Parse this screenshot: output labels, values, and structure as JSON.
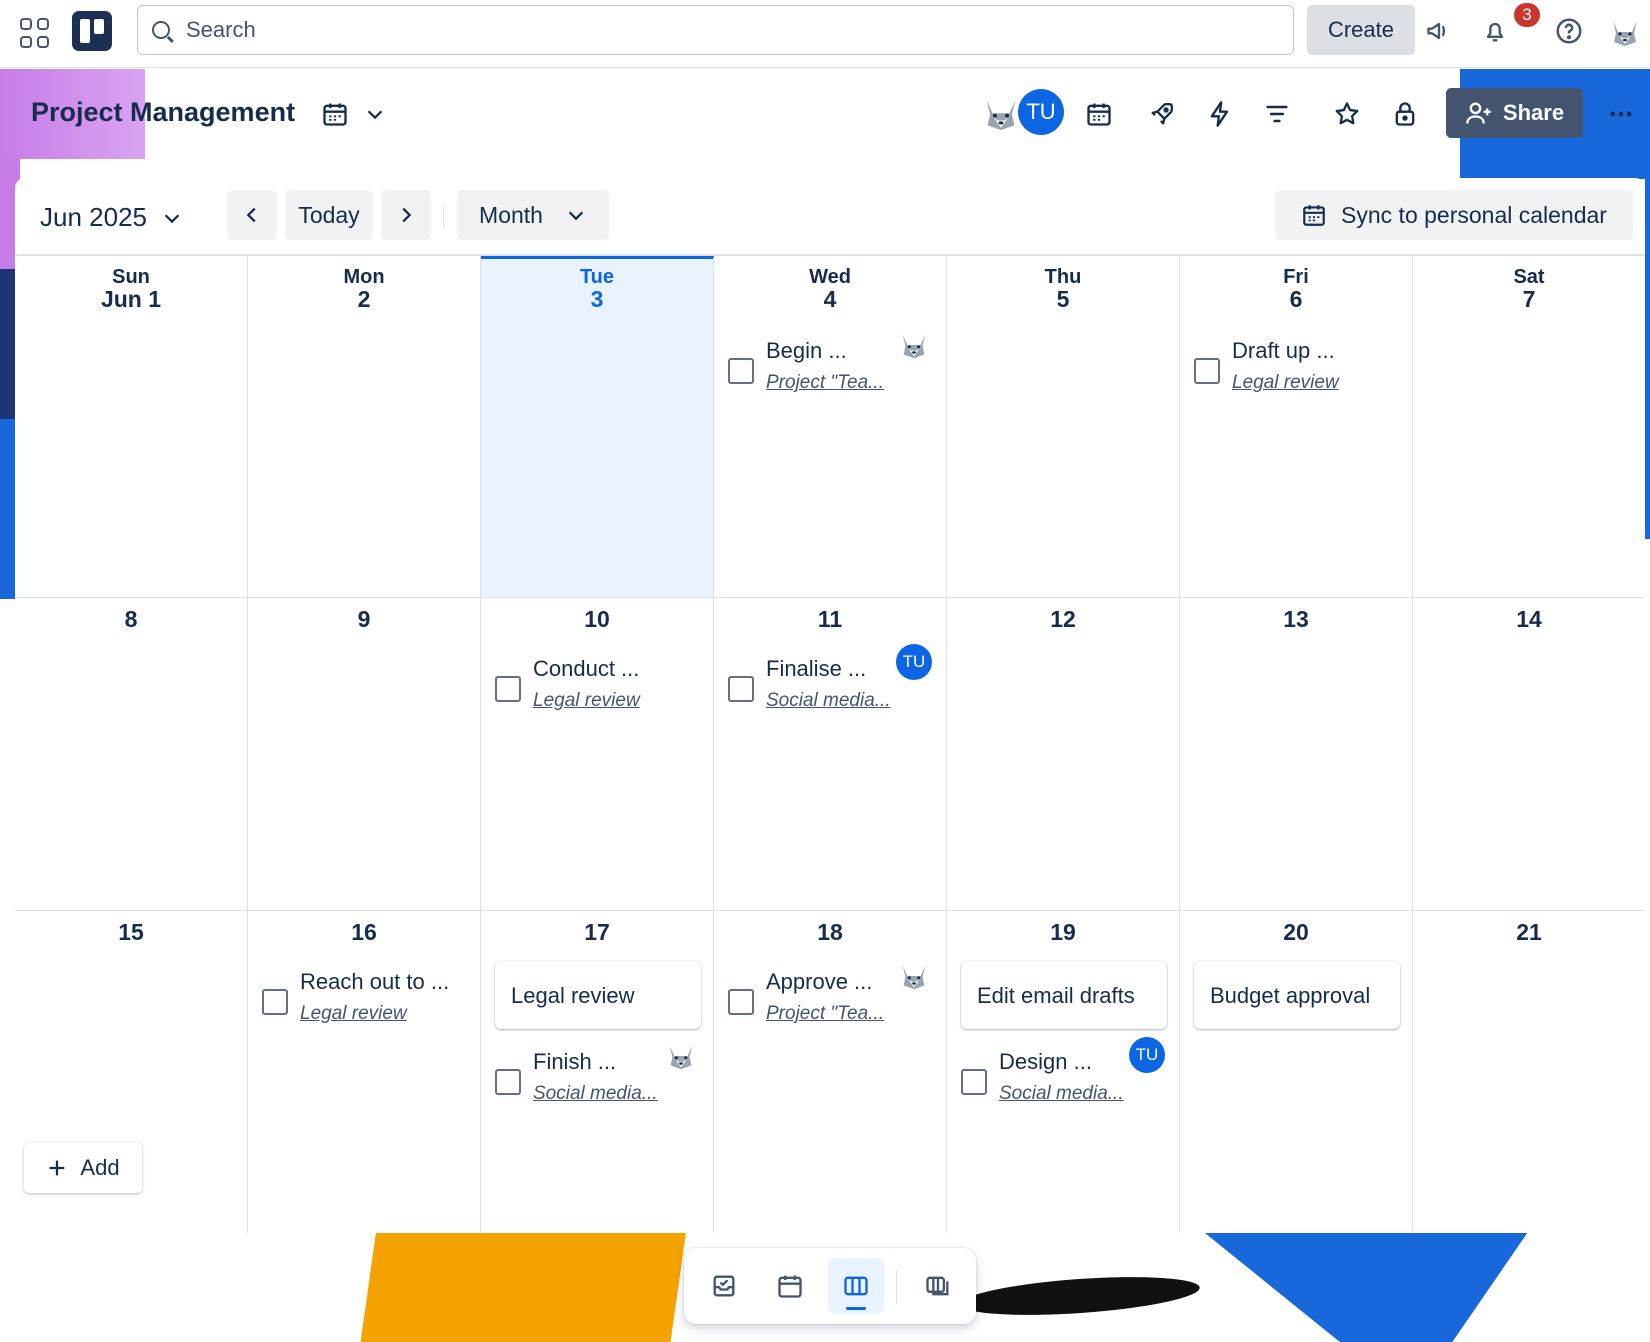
{
  "topnav": {
    "search_placeholder": "Search",
    "create_label": "Create",
    "notification_count": "3"
  },
  "board": {
    "title": "Project Management",
    "share_label": "Share",
    "member_initials": "TU"
  },
  "calendar": {
    "month_label": "Jun 2025",
    "today_label": "Today",
    "view_label": "Month",
    "sync_label": "Sync to personal calendar",
    "add_label": "Add",
    "weeks": [
      [
        {
          "name": "Sun",
          "num": "Jun 1"
        },
        {
          "name": "Mon",
          "num": "2"
        },
        {
          "name": "Tue",
          "num": "3",
          "today": true
        },
        {
          "name": "Wed",
          "num": "4"
        },
        {
          "name": "Thu",
          "num": "5"
        },
        {
          "name": "Fri",
          "num": "6"
        },
        {
          "name": "Sat",
          "num": "7"
        }
      ],
      [
        {
          "num": "8"
        },
        {
          "num": "9"
        },
        {
          "num": "10"
        },
        {
          "num": "11"
        },
        {
          "num": "12"
        },
        {
          "num": "13"
        },
        {
          "num": "14"
        }
      ],
      [
        {
          "num": "15"
        },
        {
          "num": "16"
        },
        {
          "num": "17"
        },
        {
          "num": "18"
        },
        {
          "num": "19"
        },
        {
          "num": "20"
        },
        {
          "num": "21"
        }
      ]
    ],
    "tasks": {
      "w0_wed": {
        "title": "Begin ...",
        "list": "Project \"Tea...",
        "avatar": "husky"
      },
      "w0_fri": {
        "title": "Draft up ...",
        "list": "Legal review"
      },
      "w1_tue": {
        "title": "Conduct ...",
        "list": "Legal review"
      },
      "w1_wed": {
        "title": "Finalise ...",
        "list": "Social media...",
        "avatar": "TU"
      },
      "w2_mon": {
        "title": "Reach out to ...",
        "list": "Legal review"
      },
      "w2_tue_card": "Legal review",
      "w2_tue": {
        "title": "Finish ...",
        "list": "Social media...",
        "avatar": "husky"
      },
      "w2_wed": {
        "title": "Approve ...",
        "list": "Project \"Tea...",
        "avatar": "husky"
      },
      "w2_thu_card": "Edit email drafts",
      "w2_thu": {
        "title": "Design ...",
        "list": "Social media...",
        "avatar": "TU"
      },
      "w2_fri_card": "Budget approval"
    }
  },
  "icons": {
    "colors": {
      "accent": "#0c66e4",
      "text": "#172b4d",
      "muted": "#44546f",
      "badge": "#c9372c"
    }
  }
}
